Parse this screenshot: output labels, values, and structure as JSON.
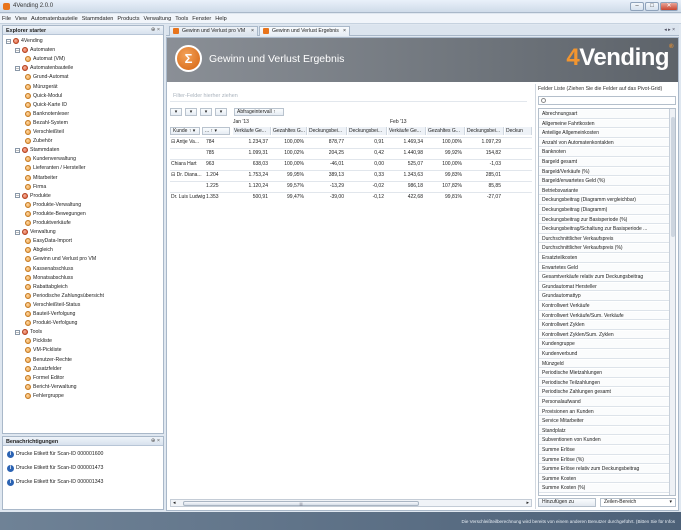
{
  "window": {
    "title": "4Vending 2.0.0",
    "controls": [
      "–",
      "□",
      "✕"
    ]
  },
  "menu": [
    "File",
    "View",
    "Automatenbauteile",
    "Stammdaten",
    "Products",
    "Verwaltung",
    "Tools",
    "Fenster",
    "Help"
  ],
  "explorer": {
    "title": "Explorer starter",
    "pin": "⊕ ×",
    "items": [
      {
        "label": "4Vending",
        "level": 0,
        "icon": "red",
        "expander": "–"
      },
      {
        "label": "Automaten",
        "level": 1,
        "icon": "red",
        "expander": "–"
      },
      {
        "label": "Automat (VM)",
        "level": 2,
        "icon": "org",
        "expander": ""
      },
      {
        "label": "Automatenbauteile",
        "level": 1,
        "icon": "red",
        "expander": "–"
      },
      {
        "label": "Grund-Automat",
        "level": 2,
        "icon": "org",
        "expander": ""
      },
      {
        "label": "Münzgerät",
        "level": 2,
        "icon": "org",
        "expander": ""
      },
      {
        "label": "Quick-Modul",
        "level": 2,
        "icon": "org",
        "expander": ""
      },
      {
        "label": "Quick-Karte ID",
        "level": 2,
        "icon": "org",
        "expander": ""
      },
      {
        "label": "Banknotenleser",
        "level": 2,
        "icon": "org",
        "expander": ""
      },
      {
        "label": "Bezahl-System",
        "level": 2,
        "icon": "org",
        "expander": ""
      },
      {
        "label": "Verschleißteil",
        "level": 2,
        "icon": "org",
        "expander": ""
      },
      {
        "label": "Zubehör",
        "level": 2,
        "icon": "org",
        "expander": ""
      },
      {
        "label": "Stammdaten",
        "level": 1,
        "icon": "red",
        "expander": "–"
      },
      {
        "label": "Kundenverwaltung",
        "level": 2,
        "icon": "org",
        "expander": ""
      },
      {
        "label": "Lieferanten / Hersteller",
        "level": 2,
        "icon": "org",
        "expander": ""
      },
      {
        "label": "Mitarbeiter",
        "level": 2,
        "icon": "org",
        "expander": ""
      },
      {
        "label": "Firma",
        "level": 2,
        "icon": "org",
        "expander": ""
      },
      {
        "label": "Produkte",
        "level": 1,
        "icon": "red",
        "expander": "–"
      },
      {
        "label": "Produkte-Verwaltung",
        "level": 2,
        "icon": "org",
        "expander": ""
      },
      {
        "label": "Produkte-Bewegungen",
        "level": 2,
        "icon": "org",
        "expander": ""
      },
      {
        "label": "Produktverkäufe",
        "level": 2,
        "icon": "org",
        "expander": ""
      },
      {
        "label": "Verwaltung",
        "level": 1,
        "icon": "red",
        "expander": "–"
      },
      {
        "label": "EasyData-Import",
        "level": 2,
        "icon": "org",
        "expander": ""
      },
      {
        "label": "Abgleich",
        "level": 2,
        "icon": "org",
        "expander": ""
      },
      {
        "label": "Gewinn und Verlust pro VM",
        "level": 2,
        "icon": "org",
        "expander": ""
      },
      {
        "label": "Kassenabschluss",
        "level": 2,
        "icon": "org",
        "expander": ""
      },
      {
        "label": "Monatsabschluss",
        "level": 2,
        "icon": "org",
        "expander": ""
      },
      {
        "label": "Rabattabgleich",
        "level": 2,
        "icon": "org",
        "expander": ""
      },
      {
        "label": "Periodische Zahlungsübersicht",
        "level": 2,
        "icon": "org",
        "expander": ""
      },
      {
        "label": "Verschleißteil-Status",
        "level": 2,
        "icon": "org",
        "expander": ""
      },
      {
        "label": "Bauteil-Verfolgung",
        "level": 2,
        "icon": "org",
        "expander": ""
      },
      {
        "label": "Produkt-Verfolgung",
        "level": 2,
        "icon": "org",
        "expander": ""
      },
      {
        "label": "Tools",
        "level": 1,
        "icon": "red",
        "expander": "–"
      },
      {
        "label": "Pickliste",
        "level": 2,
        "icon": "org",
        "expander": ""
      },
      {
        "label": "VM-Pickliste",
        "level": 2,
        "icon": "org",
        "expander": ""
      },
      {
        "label": "Benutzer-Rechte",
        "level": 2,
        "icon": "org",
        "expander": ""
      },
      {
        "label": "Zusatzfelder",
        "level": 2,
        "icon": "org",
        "expander": ""
      },
      {
        "label": "Formel Editor",
        "level": 2,
        "icon": "org",
        "expander": ""
      },
      {
        "label": "Bericht-Verwaltung",
        "level": 2,
        "icon": "org",
        "expander": ""
      },
      {
        "label": "Fehlergruppe",
        "level": 2,
        "icon": "org",
        "expander": ""
      }
    ]
  },
  "reminders": {
    "title": "Benachrichtigungen",
    "pin": "⊕ ×",
    "items": [
      "Drucke Etikett für Scan-ID 000001600",
      "Drucke Etikett für Scan-ID 000001473",
      "Drucke Etikett für Scan-ID 000001343"
    ]
  },
  "tabs": [
    {
      "label": "Gewinn und Verlust pro VM",
      "close": "×",
      "active": false
    },
    {
      "label": "Gewinn und Verlust Ergebnis",
      "close": "×",
      "active": true
    }
  ],
  "tab_nav": "◂ ▸ ×",
  "report": {
    "title": "Gewinn und Verlust Ergebnis",
    "logo_glyph": "Σ",
    "brand_prefix": "4",
    "brand_name": "Vending",
    "brand_tm": "®",
    "filter_placeholder": "Filter-Felder hierher ziehen"
  },
  "pivot": {
    "top_buttons": [
      "▾",
      "▾",
      "▾",
      "▾"
    ],
    "interval_button": "Abfrageintervall ↑",
    "periods": [
      "Jan '13",
      "Feb '13"
    ],
    "row_headers": [
      "Kunde ↑ ▾",
      "... ↑ ▾"
    ],
    "col_headers": [
      "Verkäufe Ge...",
      "Gezahltes G...",
      "Deckungsbei...",
      "Deckungsbei...",
      "Verkäufe Ge...",
      "Gezahltes G...",
      "Deckungsbei...",
      "Deckun"
    ],
    "rows": [
      {
        "kunde": "⊟ Antje Va...",
        "id": "784",
        "vals": [
          "1.234,37",
          "100,00%",
          "878,77",
          "0,91",
          "1.469,34",
          "100,00%",
          "1.097,29",
          ""
        ]
      },
      {
        "kunde": "",
        "id": "785",
        "vals": [
          "1.099,31",
          "100,02%",
          "204,25",
          "0,42",
          "1.440,98",
          "99,92%",
          "154,82",
          ""
        ]
      },
      {
        "kunde": "Chiara Hart",
        "id": "963",
        "vals": [
          "638,03",
          "100,00%",
          "-46,01",
          "0,00",
          "525,07",
          "100,00%",
          "-1,03",
          ""
        ]
      },
      {
        "kunde": "⊟ Dr. Diana...",
        "id": "1.204",
        "vals": [
          "1.753,24",
          "99,95%",
          "389,13",
          "0,33",
          "1.343,63",
          "99,83%",
          "285,01",
          ""
        ]
      },
      {
        "kunde": "",
        "id": "1.225",
        "vals": [
          "1.120,24",
          "99,57%",
          "-13,29",
          "-0,02",
          "986,18",
          "107,82%",
          "85,85",
          ""
        ]
      },
      {
        "kunde": "Dr. Luis Ludwig",
        "id": "1.353",
        "vals": [
          "500,91",
          "99,47%",
          "-39,00",
          "-0,12",
          "422,68",
          "99,81%",
          "-27,07",
          ""
        ]
      }
    ]
  },
  "hscroll": {
    "left": "◂",
    "grip": "|||",
    "right": "▸"
  },
  "field_list": {
    "header": "Felder Liste (Ziehen Sie die Felder auf das Pivot-Grid)",
    "search_placeholder": "",
    "items": [
      "Abrechnungsart",
      "Allgemeine Fahrtkosten",
      "Anteilige Allgemeinkosten",
      "Anzahl von Automatenkontakten",
      "Banknoten",
      "Bargeld gesamt",
      "Bargeld/Verkäufe (%)",
      "Bargeld/erwartetes Geld (%)",
      "Betriebsvariante",
      "Deckungsbeitrag (Diagramm vergleichbar)",
      "Deckungsbeitrag (Diagramm)",
      "Deckungsbeitrag zur Basisperiode (%)",
      "Deckungsbeitrag/Schaltung zur Basisperiode ...",
      "Durchschnittlicher Verkaufspreis",
      "Durchschnittlicher Verkaufspreis (%)",
      "Ersatzteilkosten",
      "Erwartetes Geld",
      "Gesamtverkäufe relativ zum Deckungsbeitrag",
      "Grundautomat Hersteller",
      "Grundautomattyp",
      "Kontrollwert Verkäufe",
      "Kontrollwert Verkäufe/Sum. Verkäufe",
      "Kontrollwert Zyklen",
      "Kontrollwert Zyklen/Sum. Zyklen",
      "Kundengruppe",
      "Kundenverbund",
      "Münzgeld",
      "Periodische Mietzahlungen",
      "Periodische Teilzahlungen",
      "Periodische Zahlungen gesamt",
      "Personalaufwand",
      "Provisionen an Kunden",
      "Service Mitarbeiter",
      "Standplatz",
      "Subventionen von Kunden",
      "Summe Erlöse",
      "Summe Erlöse (%)",
      "Summe Erlöse relativ zum Deckungsbeitrag",
      "Summe Kosten",
      "Summe Kosten (%)"
    ],
    "add_button": "Hinzufügen zu",
    "area_select": "Zeilen-Bereich",
    "area_arrow": "▾"
  },
  "status": {
    "text": "Die Verschleißteilberechnung wird bereits von einem anderen Benutzer durchgeführt. (Bitten Sie für Infos"
  }
}
